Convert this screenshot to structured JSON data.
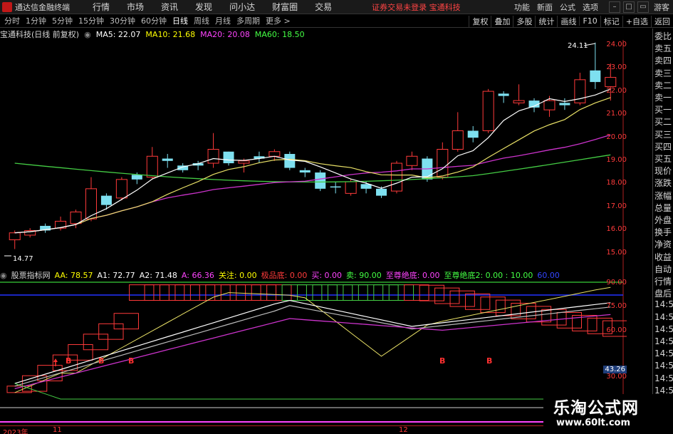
{
  "window": {
    "app_title": "通达信金融终端",
    "menu": [
      "行情",
      "市场",
      "资讯",
      "发现",
      "问小达",
      "财富圈",
      "交易"
    ],
    "notice": "证券交易未登录  宝通科技",
    "right_menu": [
      "功能",
      "新面",
      "公式",
      "选项"
    ],
    "guest": "游客"
  },
  "toolbar": {
    "periods": [
      "分时",
      "1分钟",
      "5分钟",
      "15分钟",
      "30分钟",
      "60分钟",
      "日线",
      "周线",
      "月线",
      "多周期",
      "更多 >"
    ],
    "active_period": "日线",
    "right_buttons": [
      "复权",
      "叠加",
      "多股",
      "统计",
      "画线",
      "F10",
      "标记",
      "+自选",
      "返回"
    ]
  },
  "main_chart": {
    "stock_title": "宝通科技(日线 前复权)",
    "ma_labels": [
      {
        "text": "MA5: 22.07",
        "color": "#ffffff"
      },
      {
        "text": "MA10: 21.68",
        "color": "#ffff00"
      },
      {
        "text": "MA20: 20.08",
        "color": "#ff44ff"
      },
      {
        "text": "MA60: 18.50",
        "color": "#44ff44"
      }
    ],
    "price_high_label": "24.11",
    "price_low_label": "14.77",
    "y_ticks": [
      "24.00",
      "23.00",
      "22.00",
      "21.00",
      "20.00",
      "19.00",
      "18.00",
      "17.00",
      "16.00",
      "15.00"
    ]
  },
  "sub_chart": {
    "indicator_name": "股票指标网",
    "readouts": [
      {
        "text": "AA: 78.57",
        "color": "#ffff00"
      },
      {
        "text": "A1: 72.77",
        "color": "#ffffff"
      },
      {
        "text": "A2: 71.48",
        "color": "#ffffff"
      },
      {
        "text": "A: 66.36",
        "color": "#ff44ff"
      },
      {
        "text": "关注: 0.00",
        "color": "#ffff00"
      },
      {
        "text": "极品底: 0.00",
        "color": "#ff3b3b"
      },
      {
        "text": "买: 0.00",
        "color": "#ff44ff"
      },
      {
        "text": "卖: 90.00",
        "color": "#44ff44"
      },
      {
        "text": "至尊绝底: 0.00",
        "color": "#ff44ff"
      },
      {
        "text": "至尊绝底2: 0.00 : 10.00",
        "color": "#44ff44"
      },
      {
        "text": "60.00",
        "color": "#3344ff"
      }
    ],
    "y_ticks": [
      "90.00",
      "75.00",
      "60.00",
      "43.26",
      "30.00"
    ],
    "b_marker": "B"
  },
  "sidebar": {
    "items": [
      "委比",
      "卖五",
      "卖四",
      "卖三",
      "卖二",
      "卖一",
      "买一",
      "买二",
      "买三",
      "买四",
      "买五",
      "现价",
      "涨跌",
      "涨幅",
      "总量",
      "外盘",
      "换手",
      "净资",
      "收益",
      "自动",
      "行情",
      "盘后",
      "14:5",
      "14:5",
      "14:5",
      "14:5",
      "14:5",
      "14:5",
      "14:5",
      "14:5"
    ]
  },
  "bottom_axis": {
    "labels": [
      "2023年",
      "11",
      "12"
    ]
  },
  "watermark": {
    "title": "乐淘公式网",
    "url": "www.60lt.com"
  }
}
